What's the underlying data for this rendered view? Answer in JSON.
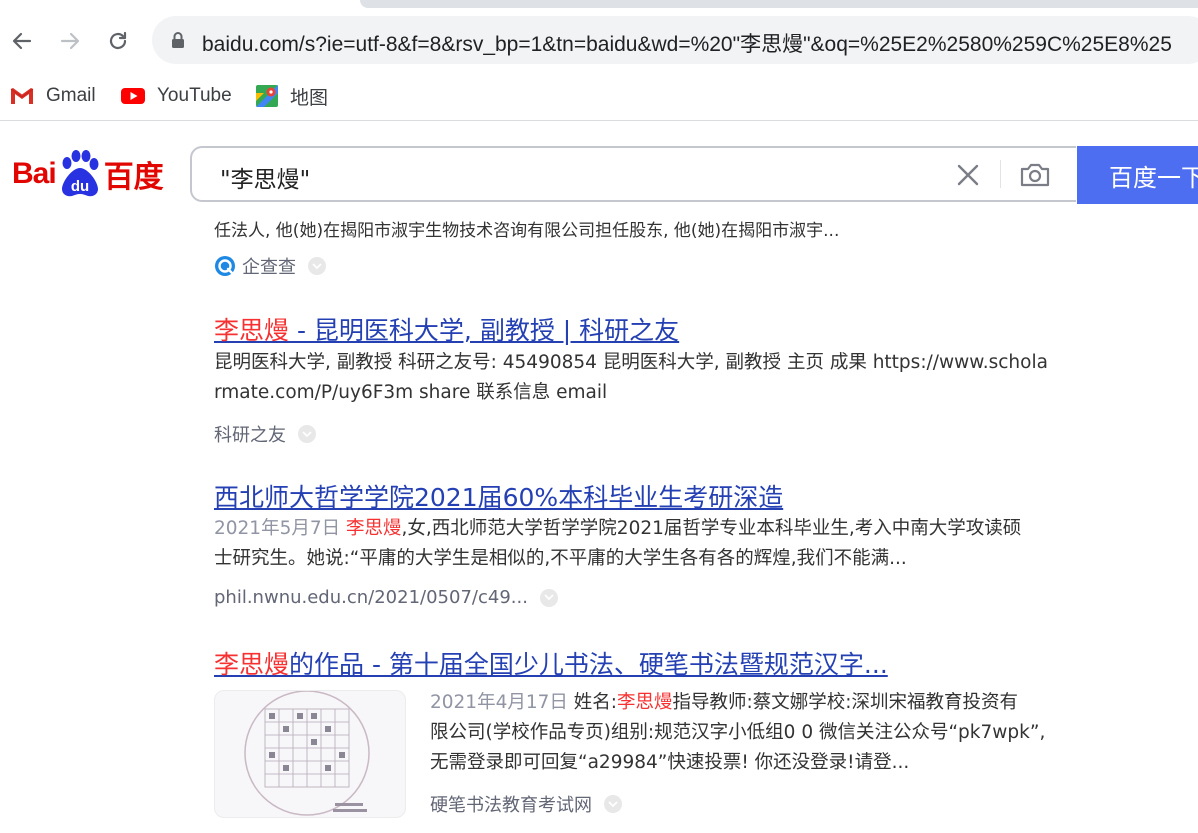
{
  "browser": {
    "url": "baidu.com/s?ie=utf-8&f=8&rsv_bp=1&tn=baidu&wd=%20\"李思熳\"&oq=%25E2%2580%259C%25E8%25",
    "bookmarks": [
      {
        "label": "Gmail",
        "icon": "gmail-icon"
      },
      {
        "label": "YouTube",
        "icon": "youtube-icon"
      },
      {
        "label": "地图",
        "icon": "maps-icon"
      }
    ]
  },
  "baidu": {
    "logo_bai": "Bai",
    "logo_du": "du",
    "logo_cn": "百度",
    "query": "\"李思熳\"",
    "search_button": "百度一下"
  },
  "results": {
    "cut_line": "任法人, 他(她)在揭阳市淑宇生物技术咨询有限公司担任股东, 他(她)在揭阳市淑宇...",
    "cut_source": "企查查",
    "items": [
      {
        "title_hl": "李思熳",
        "title_rest": " - 昆明医科大学, 副教授 | 科研之友",
        "abstract_line1": "昆明医科大学, 副教授 科研之友号: 45490854 昆明医科大学, 副教授 主页 成果 https://www.schola",
        "abstract_line2": "rmate.com/P/uy6F3m share 联系信息 email",
        "source": "科研之友"
      },
      {
        "title": "西北师大哲学学院2021届60%本科毕业生考研深造",
        "date": "2021年5月7日",
        "abstract_hl": "李思熳",
        "abstract_line1_rest": ",女,西北师范大学哲学学院2021届哲学专业本科毕业生,考入中南大学攻读硕",
        "abstract_line2": "士研究生。她说:“平庸的大学生是相似的,不平庸的大学生各有各的辉煌,我们不能满...",
        "source": "phil.nwnu.edu.cn/2021/0507/c49..."
      },
      {
        "title_hl": "李思熳",
        "title_rest": "的作品 - 第十届全国少儿书法、硬笔书法暨规范汉字...",
        "date": "2021年4月17日",
        "abstract_pre": "姓名:",
        "abstract_hl": "李思熳",
        "abstract_line1_rest": "指导教师:蔡文娜学校:深圳宋福教育投资有",
        "abstract_line2": "限公司(学校作品专页)组别:规范汉字小低组0 0 微信关注公众号“pk7wpk”,",
        "abstract_line3": "无需登录即可回复“a29984”快速投票! 你还没登录!请登...",
        "source": "硬笔书法教育考试网"
      }
    ]
  },
  "colors": {
    "baidu_red": "#e10602",
    "baidu_blue": "#4e6ef2",
    "link_blue": "#2440b3",
    "highlight_red": "#f73131"
  }
}
